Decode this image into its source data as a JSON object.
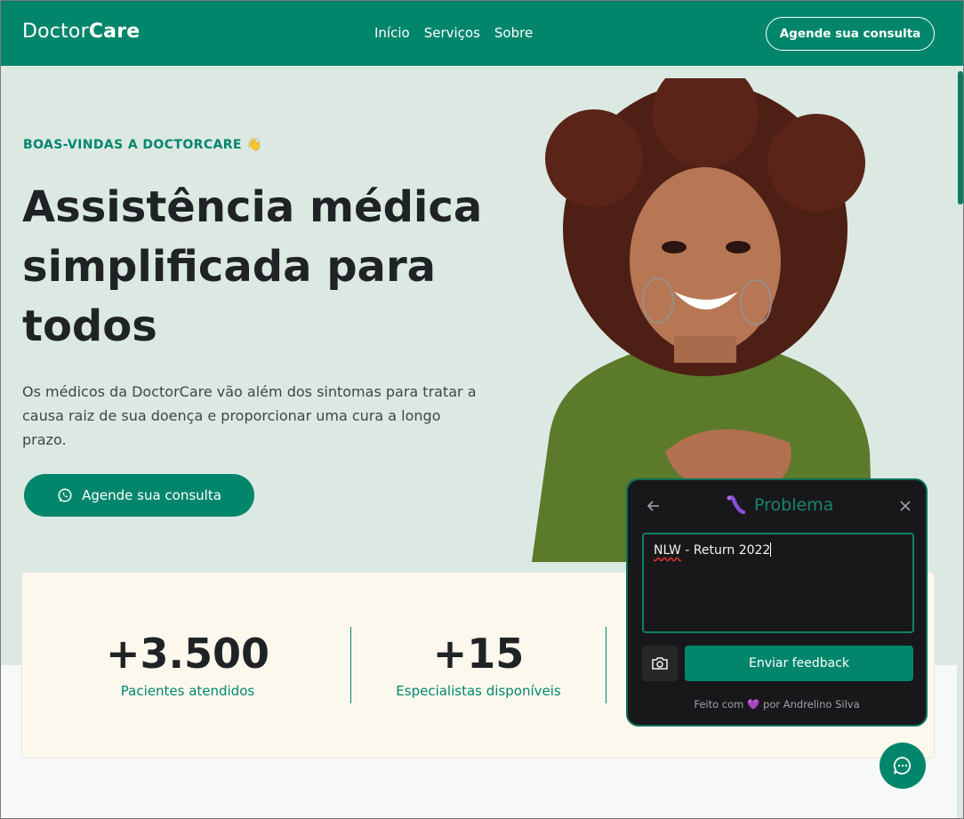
{
  "header": {
    "logo_light": "Doctor",
    "logo_bold": "Care",
    "nav": [
      "Início",
      "Serviços",
      "Sobre"
    ],
    "cta_label": "Agende sua consulta"
  },
  "hero": {
    "eyebrow": "BOAS-VINDAS A DOCTORCARE 👋",
    "headline": "Assistência médica simplificada para todos",
    "lead": "Os médicos da DoctorCare vão além dos sintomas para tratar a causa raiz de sua doença e proporcionar uma cura a longo prazo.",
    "cta_label": "Agende sua consulta",
    "cta_icon": "whatsapp-icon"
  },
  "stats": [
    {
      "value": "+3.500",
      "label": "Pacientes atendidos"
    },
    {
      "value": "+15",
      "label": "Especialistas disponíveis"
    }
  ],
  "widget": {
    "title": "Problema",
    "title_icon": "bug-icon",
    "textarea_value_misspelled": "NLW",
    "textarea_value_rest": " - Return 2022",
    "submit_label": "Enviar feedback",
    "footer_before": "Feito com",
    "footer_after": "por Andrelino Silva",
    "footer_icon": "💜"
  },
  "colors": {
    "brand": "#01866b",
    "hero_bg": "#dce9e3",
    "stats_bg": "#fdf8ee",
    "widget_bg": "#18181b"
  }
}
